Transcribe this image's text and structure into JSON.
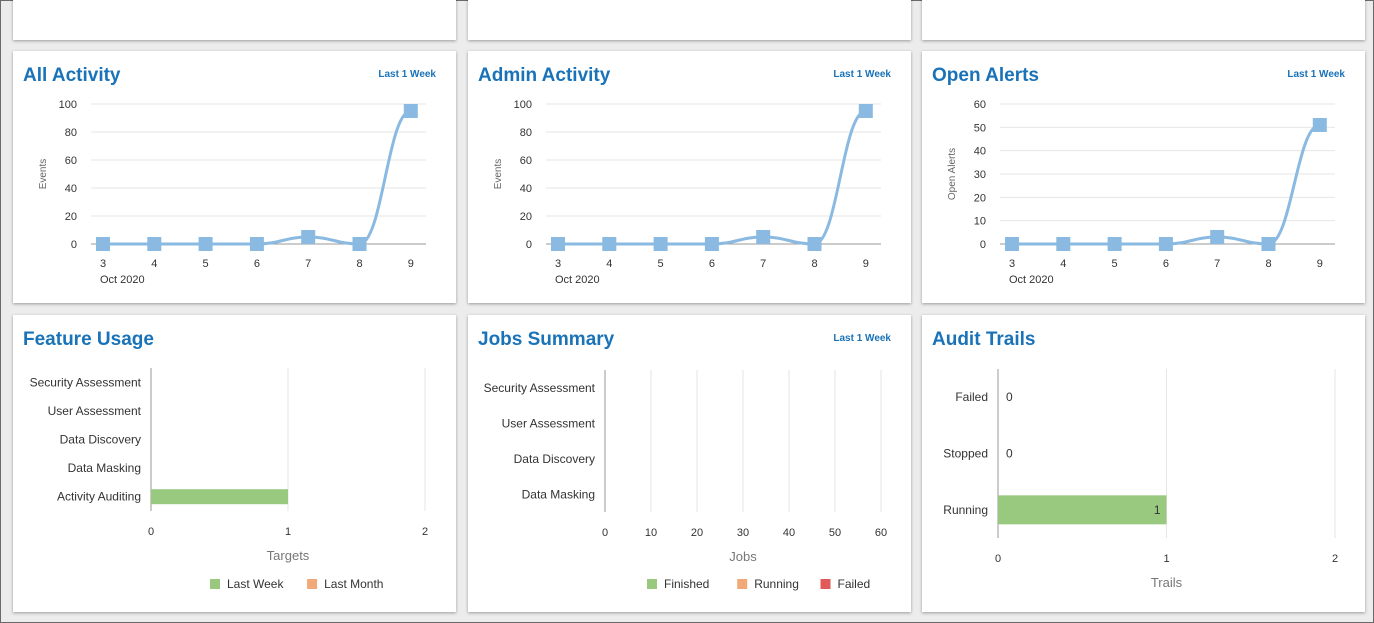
{
  "top_cards": [
    "",
    "",
    ""
  ],
  "colors": {
    "title": "#1a73b8",
    "line": "#8ab9e2",
    "marker": "#8ab9e2",
    "axis": "#9a9a9a",
    "grid": "#e6e6e6",
    "finished": "#98c97e",
    "running": "#f1a97a",
    "failed": "#e05a5a",
    "last_week": "#98c97e",
    "last_month": "#f1a97a"
  },
  "cards": {
    "all_activity": {
      "title": "All Activity",
      "range_link": "Last 1 Week",
      "chart_data": {
        "type": "line",
        "x": [
          3,
          4,
          5,
          6,
          7,
          8,
          9
        ],
        "x_tick_labels": [
          "3",
          "4",
          "5",
          "6",
          "7",
          "8",
          "9"
        ],
        "x_sublabel": "Oct 2020",
        "y": [
          0,
          0,
          0,
          0,
          5,
          0,
          95
        ],
        "ylabel": "Events",
        "ylim": [
          0,
          100
        ],
        "y_ticks": [
          0,
          20,
          40,
          60,
          80,
          100
        ],
        "grid": true
      }
    },
    "admin_activity": {
      "title": "Admin Activity",
      "range_link": "Last 1 Week",
      "chart_data": {
        "type": "line",
        "x": [
          3,
          4,
          5,
          6,
          7,
          8,
          9
        ],
        "x_tick_labels": [
          "3",
          "4",
          "5",
          "6",
          "7",
          "8",
          "9"
        ],
        "x_sublabel": "Oct 2020",
        "y": [
          0,
          0,
          0,
          0,
          5,
          0,
          95
        ],
        "ylabel": "Events",
        "ylim": [
          0,
          100
        ],
        "y_ticks": [
          0,
          20,
          40,
          60,
          80,
          100
        ],
        "grid": true
      }
    },
    "open_alerts": {
      "title": "Open Alerts",
      "range_link": "Last 1 Week",
      "chart_data": {
        "type": "line",
        "x": [
          3,
          4,
          5,
          6,
          7,
          8,
          9
        ],
        "x_tick_labels": [
          "3",
          "4",
          "5",
          "6",
          "7",
          "8",
          "9"
        ],
        "x_sublabel": "Oct 2020",
        "y": [
          0,
          0,
          0,
          0,
          3,
          0,
          51
        ],
        "ylabel": "Open Alerts",
        "ylim": [
          0,
          60
        ],
        "y_ticks": [
          0,
          10,
          20,
          30,
          40,
          50,
          60
        ],
        "grid": true
      }
    },
    "feature_usage": {
      "title": "Feature Usage",
      "chart_data": {
        "type": "bar",
        "orientation": "horizontal",
        "categories": [
          "Security Assessment",
          "User Assessment",
          "Data Discovery",
          "Data Masking",
          "Activity Auditing"
        ],
        "series": [
          {
            "name": "Last Week",
            "values": [
              0,
              0,
              0,
              0,
              1
            ]
          },
          {
            "name": "Last Month",
            "values": [
              0,
              0,
              0,
              0,
              0
            ]
          }
        ],
        "xlabel": "Targets",
        "xlim": [
          0,
          2
        ],
        "x_ticks": [
          0,
          1,
          2
        ],
        "legend": "bottom"
      }
    },
    "jobs_summary": {
      "title": "Jobs Summary",
      "range_link": "Last 1 Week",
      "chart_data": {
        "type": "bar",
        "orientation": "horizontal",
        "categories": [
          "Security Assessment",
          "User Assessment",
          "Data Discovery",
          "Data Masking"
        ],
        "series": [
          {
            "name": "Finished",
            "values": [
              0,
              0,
              0,
              0
            ]
          },
          {
            "name": "Running",
            "values": [
              0,
              0,
              0,
              0
            ]
          },
          {
            "name": "Failed",
            "values": [
              0,
              0,
              0,
              0
            ]
          }
        ],
        "xlabel": "Jobs",
        "xlim": [
          0,
          60
        ],
        "x_ticks": [
          0,
          10,
          20,
          30,
          40,
          50,
          60
        ],
        "legend": "bottom"
      }
    },
    "audit_trails": {
      "title": "Audit Trails",
      "chart_data": {
        "type": "bar",
        "orientation": "horizontal",
        "categories": [
          "Failed",
          "Stopped",
          "Running"
        ],
        "values": [
          0,
          0,
          1
        ],
        "data_labels": [
          "0",
          "0",
          "1"
        ],
        "xlabel": "Trails",
        "xlim": [
          0,
          2
        ],
        "x_ticks": [
          0,
          1,
          2
        ]
      }
    }
  }
}
